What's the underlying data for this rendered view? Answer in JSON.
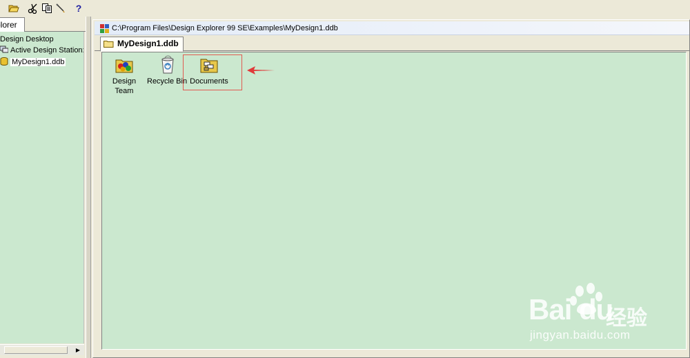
{
  "toolbar": {
    "buttons": [
      {
        "icon": "open-folder-icon"
      },
      {
        "icon": "cut-icon"
      },
      {
        "icon": "copy-icon"
      },
      {
        "icon": "paste-icon"
      },
      {
        "icon": "help-icon",
        "label": "?"
      }
    ]
  },
  "explorer": {
    "tab_label": "plorer",
    "tree": [
      {
        "label": "Design Desktop",
        "icon": ""
      },
      {
        "label": "Active Design Station:",
        "icon": "station-icon"
      },
      {
        "label": "MyDesign1.ddb",
        "icon": "database-icon",
        "selected": true
      }
    ]
  },
  "document": {
    "title": "C:\\Program Files\\Design Explorer 99 SE\\Examples\\MyDesign1.ddb",
    "tab_label": "MyDesign1.ddb",
    "items": [
      {
        "label_line1": "Design",
        "label_line2": "Team",
        "icon": "design-team-icon"
      },
      {
        "label_line1": "Recycle Bin",
        "label_line2": "",
        "icon": "recycle-bin-icon"
      },
      {
        "label_line1": "Documents",
        "label_line2": "",
        "icon": "documents-icon"
      }
    ]
  },
  "watermark": {
    "logo_text": "Bai du",
    "jingyan_text": "经验",
    "url": "jingyan.baidu.com"
  },
  "colors": {
    "canvas_bg": "#cbe8cf",
    "window_bg": "#ece9d8",
    "highlight_box": "#e05a50",
    "arrow": "#e03a3a"
  }
}
